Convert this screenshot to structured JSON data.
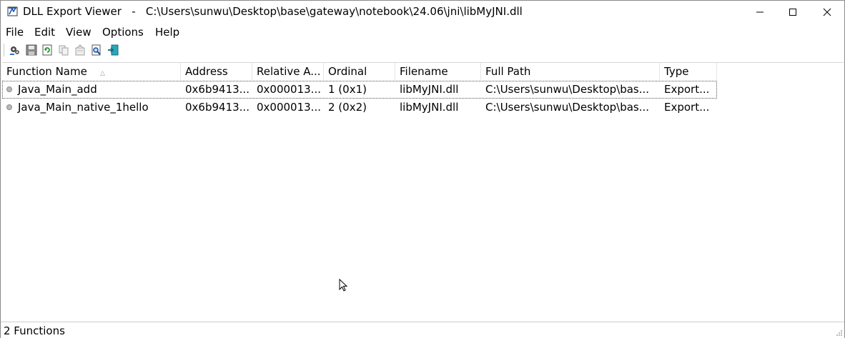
{
  "window": {
    "title": "DLL Export Viewer   -   C:\\Users\\sunwu\\Desktop\\base\\gateway\\notebook\\24.06\\jni\\libMyJNI.dll"
  },
  "menu": [
    "File",
    "Edit",
    "View",
    "Options",
    "Help"
  ],
  "toolbar": {
    "icons": [
      "properties-gear-icon",
      "save-icon",
      "refresh-icon",
      "copy-icon",
      "html-report-icon",
      "find-icon",
      "exit-icon"
    ]
  },
  "columns": [
    "Function Name",
    "Address",
    "Relative A...",
    "Ordinal",
    "Filename",
    "Full Path",
    "Type"
  ],
  "rows": [
    [
      "Java_Main_add",
      "0x6b9413...",
      "0x000013...",
      "1 (0x1)",
      "libMyJNI.dll",
      "C:\\Users\\sunwu\\Desktop\\bas...",
      "Export..."
    ],
    [
      "Java_Main_native_1hello",
      "0x6b9413...",
      "0x000013...",
      "2 (0x2)",
      "libMyJNI.dll",
      "C:\\Users\\sunwu\\Desktop\\bas...",
      "Export..."
    ]
  ],
  "status": {
    "text": "2 Functions"
  }
}
